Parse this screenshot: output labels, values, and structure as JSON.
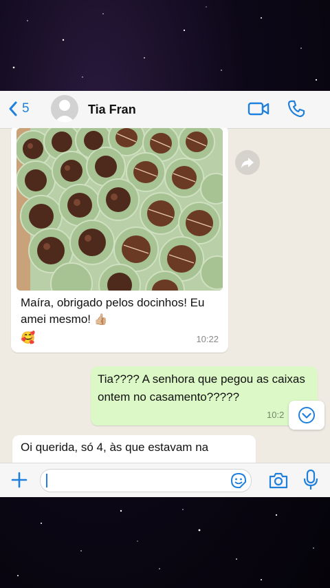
{
  "header": {
    "back_count": "5",
    "contact_name": "Tia Fran"
  },
  "messages": {
    "incoming_1": {
      "text": "Maíra, obrigado pelos docinhos! Eu amei mesmo!",
      "time": "10:22"
    },
    "outgoing_1": {
      "text": "Tia???? A senhora que pegou as caixas ontem no casamento?????",
      "time": "10:2"
    },
    "incoming_2": {
      "text": "Oi querida, só 4, às que estavam na"
    }
  },
  "icons": {
    "back": "chevron-left-icon",
    "avatar": "person-icon",
    "video": "video-camera-icon",
    "call": "phone-icon",
    "forward": "forward-icon",
    "scroll_down": "chevron-down-icon",
    "plus": "plus-icon",
    "sticker": "sticker-icon",
    "camera": "camera-icon",
    "mic": "microphone-icon"
  },
  "colors": {
    "accent": "#1f7fdc",
    "chat_background": "#efeae2",
    "outgoing_bubble": "#dcf8c6",
    "incoming_bubble": "#ffffff"
  }
}
